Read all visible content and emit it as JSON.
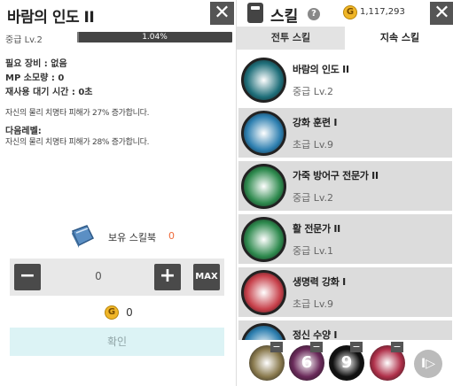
{
  "left": {
    "title": "바람의 인도 II",
    "grade": "중급 Lv.2",
    "exp_percent": "1.04%",
    "exp_fraction": 0.0104,
    "required_equip": "필요 장비 : 없음",
    "mp_cost": "MP 소모량 : 0",
    "cooldown": "재사용 대기 시간 : 0초",
    "current_effect": "자신의 물리 치명타 피해가 27% 증가합니다.",
    "next_level_label": "다음레벨:",
    "next_effect": "자신의 물리 치명타 피해가 28% 증가합니다.",
    "book_label": "보유 스킬북",
    "book_count": "0",
    "minus_label": "−",
    "plus_label": "+",
    "max_label": "MAX",
    "quantity": "0",
    "coin_glyph": "G",
    "cost": "0",
    "confirm_label": "확인",
    "close_label": "✕"
  },
  "right": {
    "title": "스킬",
    "help_label": "?",
    "coin_glyph": "G",
    "gold": "1,117,293",
    "close_label": "✕",
    "tabs": [
      {
        "label": "전투 스킬",
        "active": false
      },
      {
        "label": "지속 스킬",
        "active": true
      }
    ],
    "skills": [
      {
        "name": "바람의 인도 II",
        "level": "중급 Lv.2",
        "icon": "wind-guide-icon",
        "color": "#1f6f7a",
        "selected": true
      },
      {
        "name": "강화 훈련 I",
        "level": "초급 Lv.9",
        "icon": "paw-icon",
        "color": "#2d7fb0",
        "selected": false
      },
      {
        "name": "가죽 방어구 전문가 II",
        "level": "중급 Lv.2",
        "icon": "leather-armor-icon",
        "color": "#2e8a4e",
        "selected": false
      },
      {
        "name": "활 전문가 II",
        "level": "중급 Lv.1",
        "icon": "bow-icon",
        "color": "#2e8a4e",
        "selected": false
      },
      {
        "name": "생명력 강화 I",
        "level": "초급 Lv.9",
        "icon": "heart-icon",
        "color": "#c7404a",
        "selected": false
      },
      {
        "name": "정신 수양 I",
        "level": "",
        "icon": "mind-icon",
        "color": "#2d7fb0",
        "selected": false
      }
    ],
    "quickbar": [
      {
        "icon": "wind-arrow-icon",
        "num": "",
        "color": "#8a7a4e"
      },
      {
        "icon": "purple-skill-icon",
        "num": "6",
        "color": "#6a2a5a"
      },
      {
        "icon": "dark-skill-icon",
        "num": "9",
        "color": "#111111"
      },
      {
        "icon": "eye-skill-icon",
        "num": "",
        "color": "#b0304a"
      }
    ],
    "next_label": "I▷"
  }
}
